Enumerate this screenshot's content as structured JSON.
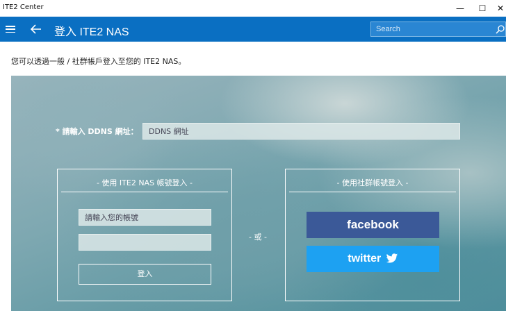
{
  "window": {
    "title": "ITE2 Center",
    "minimize_glyph": "—",
    "maximize_glyph": "☐",
    "close_glyph": "✕"
  },
  "header": {
    "title": "登入 ITE2 NAS",
    "search_placeholder": "Search",
    "menu_icon": "hamburger-icon",
    "back_icon": "back-arrow-icon",
    "search_icon": "search-icon",
    "color": "#0a6fc2"
  },
  "intro": "您可以透過一般 / 社群帳戶登入至您的 ITE2 NAS。",
  "ddns": {
    "label": "* 請輸入 DDNS 網址：",
    "placeholder": "DDNS 網址"
  },
  "nas_login": {
    "title": "- 使用 ITE2 NAS 帳號登入 -",
    "account_placeholder": "請輸入您的帳號",
    "password_placeholder": "",
    "login_label": "登入"
  },
  "separator": "- 或 -",
  "social_login": {
    "title": "- 使用社群帳號登入 -",
    "facebook_label": "facebook",
    "twitter_label": "twitter",
    "facebook_color": "#3b5998",
    "twitter_color": "#1da1f2"
  }
}
